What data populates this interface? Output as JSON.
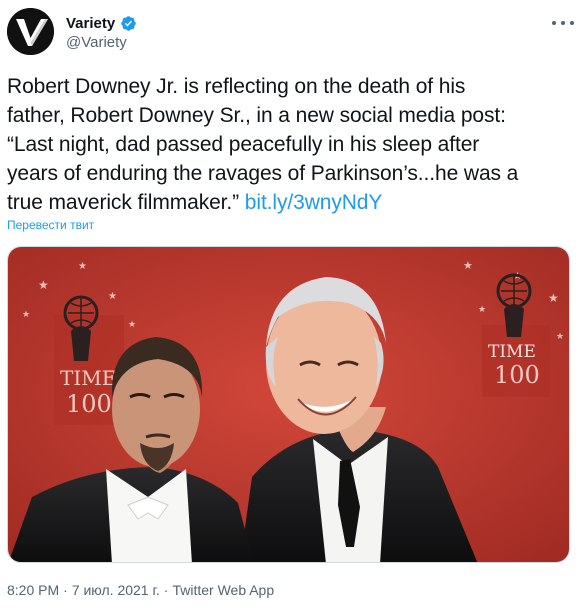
{
  "author": {
    "display_name": "Variety",
    "handle": "@Variety",
    "verified": true,
    "avatar_icon": "variety-logo-icon"
  },
  "menu_icon": "more-horizontal-icon",
  "tweet": {
    "text_lines": [
      "Robert Downey Jr. is reflecting on the death of his",
      "father, Robert Downey Sr., in a new social media post:",
      "“Last night, dad passed peacefully in his sleep after",
      "years of enduring the ravages of Parkinson’s...he was a",
      "true maverick filmmaker.”"
    ],
    "link": "bit.ly/3wnyNdY",
    "translate_label": "Перевести твит"
  },
  "media": {
    "backdrop_text": [
      "TIME",
      "100"
    ]
  },
  "meta": {
    "time": "8:20 PM",
    "separator": "·",
    "date": "7 июл. 2021 г.",
    "client": "Twitter Web App"
  },
  "colors": {
    "link": "#1d9bf0",
    "secondary_text": "#536471",
    "verified": "#1d9bf0",
    "backdrop_red": "#c53a2e"
  }
}
